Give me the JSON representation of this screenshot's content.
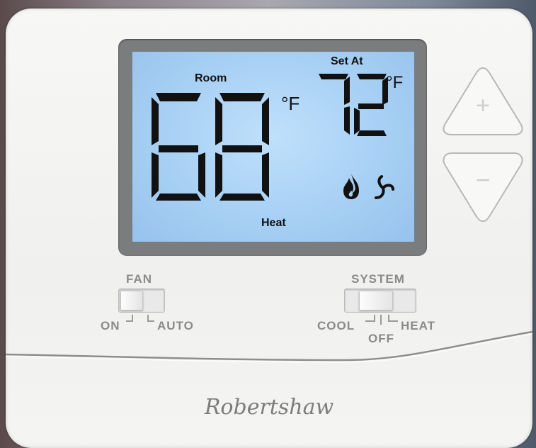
{
  "display": {
    "room_label": "Room",
    "room_temp": "68",
    "room_unit": "°F",
    "set_label": "Set At",
    "set_temp": "72",
    "set_unit": "°F",
    "mode": "Heat",
    "icons": [
      "flame-icon",
      "fan-icon"
    ]
  },
  "buttons": {
    "up_symbol": "+",
    "down_symbol": "−"
  },
  "fan_switch": {
    "title": "FAN",
    "options": [
      "ON",
      "AUTO"
    ],
    "selected": "ON"
  },
  "system_switch": {
    "title": "SYSTEM",
    "options": [
      "COOL",
      "OFF",
      "HEAT"
    ],
    "selected": "OFF"
  },
  "brand": "Robertshaw",
  "colors": {
    "lcd": "#a8d0f4",
    "bezel": "#7b7c7d",
    "body": "#f2f2f0",
    "label": "#8a8a8a"
  }
}
